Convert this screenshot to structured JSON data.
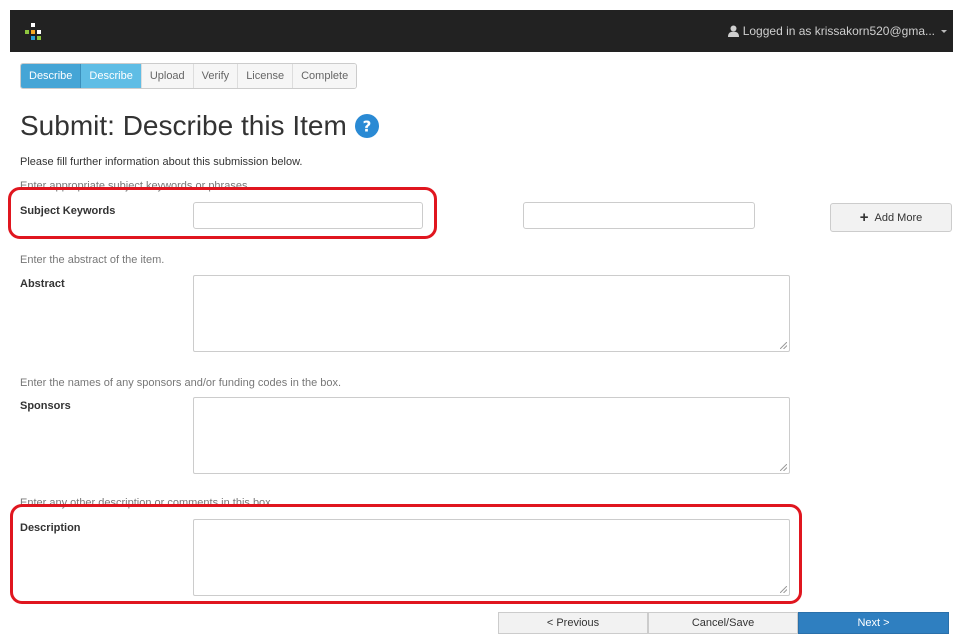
{
  "header": {
    "logged_in_text": "Logged in as krissakorn520@gma..."
  },
  "steps": [
    "Describe",
    "Describe",
    "Upload",
    "Verify",
    "License",
    "Complete"
  ],
  "page": {
    "title": "Submit: Describe this Item",
    "intro": "Please fill further information about this submission below."
  },
  "fields": {
    "subject": {
      "hint": "Enter appropriate subject keywords or phrases.",
      "label": "Subject Keywords",
      "value_1": "",
      "value_2": ""
    },
    "abstract": {
      "hint": "Enter the abstract of the item.",
      "label": "Abstract",
      "value": ""
    },
    "sponsors": {
      "hint": "Enter the names of any sponsors and/or funding codes in the box.",
      "label": "Sponsors",
      "value": ""
    },
    "description": {
      "hint": "Enter any other description or comments in this box.",
      "label": "Description",
      "value": ""
    }
  },
  "buttons": {
    "add_more": "Add More",
    "previous": "< Previous",
    "cancel_save": "Cancel/Save",
    "next": "Next >"
  },
  "colors": {
    "highlight": "#e0161f",
    "accent": "#45a5d6",
    "primary_button": "#2f7fc0"
  },
  "icons": [
    "dspace-logo-icon",
    "user-icon",
    "chevron-down-icon",
    "help-icon",
    "plus-icon"
  ]
}
